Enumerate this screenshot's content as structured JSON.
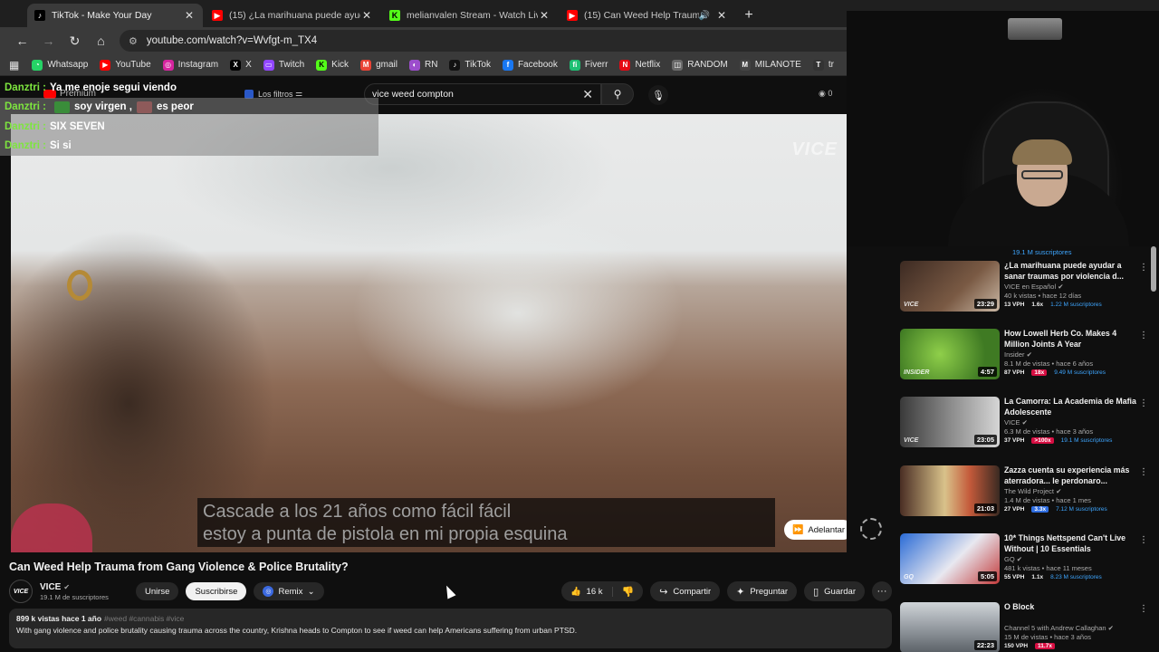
{
  "tabs": [
    {
      "title": "TikTok - Make Your Day",
      "color": "#000000",
      "glyph": "♪",
      "active": true
    },
    {
      "title": "(15) ¿La marihuana puede ayud",
      "color": "#ff0000",
      "glyph": "▶"
    },
    {
      "title": "melianvalen Stream - Watch Liv",
      "color": "#53fc18",
      "glyph": "K"
    },
    {
      "title": "(15) Can Weed Help Trauma",
      "color": "#ff0000",
      "glyph": "▶",
      "audio": true
    }
  ],
  "address": {
    "url": "youtube.com/watch?v=Wvfgt-m_TX4"
  },
  "bookmarks": [
    {
      "label": "Whatsapp",
      "color": "#25d366",
      "glyph": "◔"
    },
    {
      "label": "YouTube",
      "color": "#ff0000",
      "glyph": "▶"
    },
    {
      "label": "Instagram",
      "color": "#d6249f",
      "glyph": "◎"
    },
    {
      "label": "X",
      "color": "#000000",
      "glyph": "X"
    },
    {
      "label": "Twitch",
      "color": "#9146ff",
      "glyph": "▭"
    },
    {
      "label": "Kick",
      "color": "#53fc18",
      "glyph": "K"
    },
    {
      "label": "gmail",
      "color": "#ea4335",
      "glyph": "M"
    },
    {
      "label": "RN",
      "color": "#9c4dcc",
      "glyph": "◐"
    },
    {
      "label": "TikTok",
      "color": "#111111",
      "glyph": "♪"
    },
    {
      "label": "Facebook",
      "color": "#1877f2",
      "glyph": "f"
    },
    {
      "label": "Fiverr",
      "color": "#1dbf73",
      "glyph": "fi"
    },
    {
      "label": "Netflix",
      "color": "#e50914",
      "glyph": "N"
    },
    {
      "label": "RANDOM",
      "color": "#6a6a6a",
      "glyph": "◫"
    },
    {
      "label": "MILANOTE",
      "color": "#444444",
      "glyph": "M"
    },
    {
      "label": "tr",
      "color": "#333333",
      "glyph": "T"
    }
  ],
  "ytheader": {
    "premium_label": "Premium",
    "filters_label": "Los filtros",
    "search_value": "vice weed compton",
    "counter": "0"
  },
  "chat": [
    {
      "user": "Danztri",
      "pre": "Ya me enoje segui viendo",
      "post": "",
      "emotes": []
    },
    {
      "user": "Danztri",
      "pre": "soy virgen ,",
      "post": "es peor",
      "emotes": [
        "#3a8d3a",
        "#8e5a5a"
      ]
    },
    {
      "user": "Danztri",
      "pre": "SIX SEVEN",
      "post": "",
      "emotes": []
    },
    {
      "user": "Danztri",
      "pre": "Si si",
      "post": "",
      "emotes": []
    }
  ],
  "video": {
    "watermark": "VICE",
    "subtitle_line1": "Cascade a los 21 años como fácil fácil",
    "subtitle_line2": "estoy a punta de pistola en mi propia esquina",
    "skip_label": "Adelantar"
  },
  "watch": {
    "title": "Can Weed Help Trauma from Gang Violence & Police Brutality?",
    "channel": "VICE",
    "channel_subs": "19.1 M de suscriptores",
    "join_label": "Unirse",
    "subscribe_label": "Suscribirse",
    "remix_label": "Remix",
    "likes": "16 k",
    "share_label": "Compartir",
    "ask_label": "Preguntar",
    "save_label": "Guardar",
    "views_date": "899 k vistas  hace 1 año",
    "hashtags": "#weed #cannabis #vice",
    "description": "With gang violence and police brutality causing trauma across the country, Krishna heads to Compton to see if weed can help Americans suffering from urban PTSD."
  },
  "sidebar": {
    "top_partial": "19.1 M suscriptores",
    "items": [
      {
        "title": "¿La marihuana puede ayudar a sanar traumas por violencia d...",
        "channel": "VICE en Español",
        "views": "40 k vistas • hace 12 días",
        "duration": "23:29",
        "vph": "13 VPH",
        "mult": "1.6x",
        "subs": "1.22 M suscriptores",
        "thumb": "linear-gradient(135deg,#3c2a22,#7a5a44 60%,#c9b7a4)",
        "logo": "VICE"
      },
      {
        "title": "How Lowell Herb Co. Makes 4 Million Joints A Year",
        "channel": "Insider",
        "views": "8.1 M de vistas • hace 6 años",
        "duration": "4:57",
        "vph": "87 VPH",
        "mult": "18x",
        "subs": "9.49 M suscriptores",
        "thumb": "radial-gradient(circle at 40% 50%,#8fcf4a,#3f7a23 70%)",
        "logo": "INSIDER"
      },
      {
        "title": "La Camorra: La Academia de Mafia Adolescente",
        "channel": "VICE",
        "views": "6.3 M de vistas • hace 3 años",
        "duration": "23:05",
        "vph": "37 VPH",
        "mult": ">100x",
        "subs": "19.1 M suscriptores",
        "thumb": "linear-gradient(90deg,#3a3a3a,#8a8a8a 50%,#d6d6d6)",
        "logo": "VICE"
      },
      {
        "title": "Zazza cuenta su experiencia más aterradora... le perdonaro...",
        "channel": "The Wild Project",
        "views": "1.4 M de vistas • hace 1 mes",
        "duration": "21:03",
        "vph": "27 VPH",
        "mult": "3.3x",
        "subs": "7.12 M suscriptores",
        "thumb": "linear-gradient(90deg,#4a2e24,#d9c28a 45%,#c45a3a 70%,#3a2a22)",
        "logo": ""
      },
      {
        "title": "10* Things Nettspend Can't Live Without | 10 Essentials",
        "channel": "GQ",
        "views": "481 k vistas • hace 11 meses",
        "duration": "5:05",
        "vph": "55 VPH",
        "mult": "1.1x",
        "subs": "8.23 M suscriptores",
        "thumb": "linear-gradient(135deg,#2a6bd6,#e8e8f0 55%,#c23a3a)",
        "logo": "GQ"
      },
      {
        "title": "O Block",
        "channel": "Channel 5 with Andrew Callaghan",
        "views": "15 M de vistas • hace 3 años",
        "duration": "22:23",
        "vph": "150 VPH",
        "mult": "11.7x",
        "subs": "",
        "thumb": "linear-gradient(180deg,#cfd4d8,#8a9096 60%,#5a6066)",
        "logo": ""
      }
    ]
  }
}
